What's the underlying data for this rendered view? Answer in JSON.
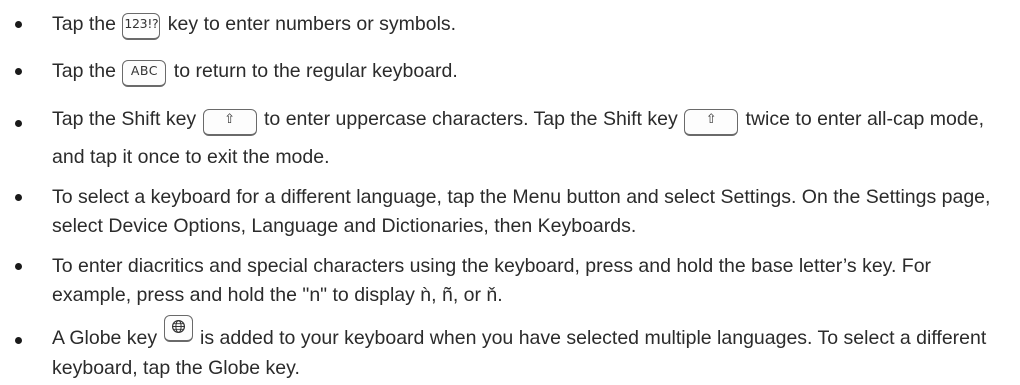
{
  "keys": {
    "numbers_symbols": "123!?",
    "abc": "ABC",
    "shift_glyph": "⇧",
    "globe": "globe-icon"
  },
  "bullets": [
    {
      "before": "Tap the ",
      "after": " key to enter numbers or symbols."
    },
    {
      "before": "Tap the ",
      "after": " to return to the regular keyboard."
    },
    {
      "before": "Tap the Shift key ",
      "middle": " to enter uppercase characters. Tap the Shift key ",
      "after": " twice to enter all-cap mode, and tap it once to exit the mode."
    },
    {
      "text": "To select a keyboard for a different language, tap the Menu button and select Settings. On the Settings page, select Device Options, Language and Dictionaries, then Keyboards."
    },
    {
      "text": "To enter diacritics and special characters using the keyboard, press and hold the base letter’s key. For example, press and hold the \"n\" to display ǹ, ñ, or ň."
    },
    {
      "before": "A Globe key ",
      "after": " is added to your keyboard when you have selected multiple languages. To select a different keyboard, tap the Globe key."
    }
  ]
}
